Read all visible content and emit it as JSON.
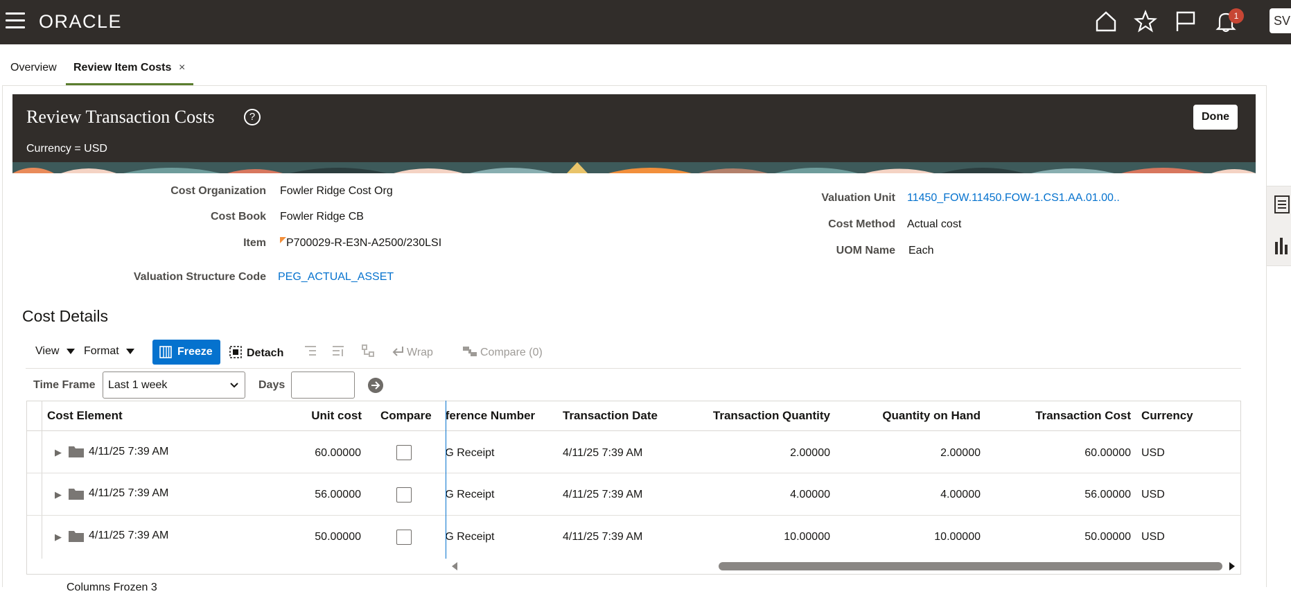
{
  "app": {
    "logo": "ORACLE",
    "notification_count": "1",
    "user_initials": "SV"
  },
  "tabs": [
    {
      "label": "Overview"
    },
    {
      "label": "Review Item Costs",
      "close": "×"
    }
  ],
  "header": {
    "title": "Review Transaction Costs",
    "help": "?",
    "currency": "Currency = USD",
    "done_label": "Done"
  },
  "form": {
    "cost_org_label": "Cost Organization",
    "cost_org_value": "Fowler Ridge Cost Org",
    "cost_book_label": "Cost Book",
    "cost_book_value": "Fowler Ridge CB",
    "item_label": "Item",
    "item_value": "P700029-R-E3N-A2500/230LSI",
    "vsc_label": "Valuation Structure Code",
    "vsc_value": "PEG_ACTUAL_ASSET",
    "valuation_unit_label": "Valuation Unit",
    "valuation_unit_value": "11450_FOW.11450.FOW-1.CS1.AA.01.00..",
    "cost_method_label": "Cost Method",
    "cost_method_value": "Actual cost",
    "uom_label": "UOM Name",
    "uom_value": "Each"
  },
  "cost_details": {
    "title": "Cost Details",
    "toolbar": {
      "view": "View",
      "format": "Format",
      "freeze": "Freeze",
      "detach": "Detach",
      "wrap": "Wrap",
      "compare": "Compare (0)"
    },
    "filter": {
      "time_frame_label": "Time Frame",
      "time_frame_value": "Last 1 week",
      "days_label": "Days",
      "days_value": ""
    },
    "columns": {
      "cost_element": "Cost Element",
      "unit_cost": "Unit cost",
      "compare": "Compare",
      "reference_number": "Reference Number",
      "transaction_date": "Transaction Date",
      "transaction_quantity": "Transaction Quantity",
      "quantity_on_hand": "Quantity on Hand",
      "transaction_cost": "Transaction Cost",
      "currency": "Currency"
    },
    "rows": [
      {
        "cost_element": "4/11/25 7:39 AM",
        "unit_cost": "60.00000",
        "reference": "PEG Receipt",
        "date": "4/11/25 7:39 AM",
        "qty": "2.00000",
        "on_hand": "2.00000",
        "cost": "60.00000",
        "currency": "USD"
      },
      {
        "cost_element": "4/11/25 7:39 AM",
        "unit_cost": "56.00000",
        "reference": "PEG Receipt",
        "date": "4/11/25 7:39 AM",
        "qty": "4.00000",
        "on_hand": "4.00000",
        "cost": "56.00000",
        "currency": "USD"
      },
      {
        "cost_element": "4/11/25 7:39 AM",
        "unit_cost": "50.00000",
        "reference": "PEG Receipt",
        "date": "4/11/25 7:39 AM",
        "qty": "10.00000",
        "on_hand": "10.00000",
        "cost": "50.00000",
        "currency": "USD"
      }
    ],
    "footer": "Columns Frozen  3"
  },
  "colors": {
    "brand_bar": "#312d2a",
    "accent": "#0572ce",
    "tab_underline": "#5b7e2f",
    "badge": "#c74634"
  }
}
